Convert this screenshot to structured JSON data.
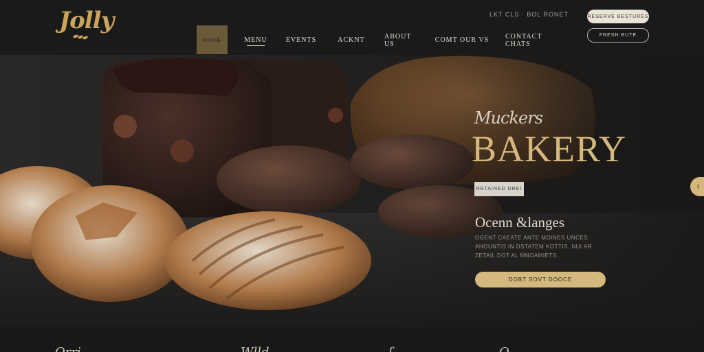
{
  "header": {
    "logo_text": "Jolly",
    "contact_text": "LKT CLS · BOL RONET",
    "nav": [
      {
        "label": "BOOK"
      },
      {
        "label": "MENU"
      },
      {
        "label": "EVENTS"
      },
      {
        "label": "ACKNT"
      },
      {
        "label": "ABOUT US"
      },
      {
        "label": "COMT OUR VS"
      },
      {
        "label": "CONTACT CHATS"
      }
    ],
    "btn_primary": "RESERVE BESTURES",
    "btn_secondary": "FRESH BUTE"
  },
  "hero": {
    "script_sub": "Muckers",
    "title": "BAKERY",
    "tag": "RETAINED DREI",
    "sub_head": "Ocenn &langes",
    "desc": "OGENT CAEATE ANTE MOINES UNCES. AHOUNTIS IN DSTATEM KOTTIS. NUI AR ZETAIL DOT AL MNOAMIETS.",
    "cta": "DOBT SOVT DOOCE",
    "side_tab": "I"
  },
  "footer": {
    "items": [
      "Orri",
      "Wlld",
      "ʃ",
      "O"
    ]
  },
  "colors": {
    "gold": "#d4b87e",
    "dark": "#1a1a1a",
    "cream": "#e9e3d8"
  }
}
